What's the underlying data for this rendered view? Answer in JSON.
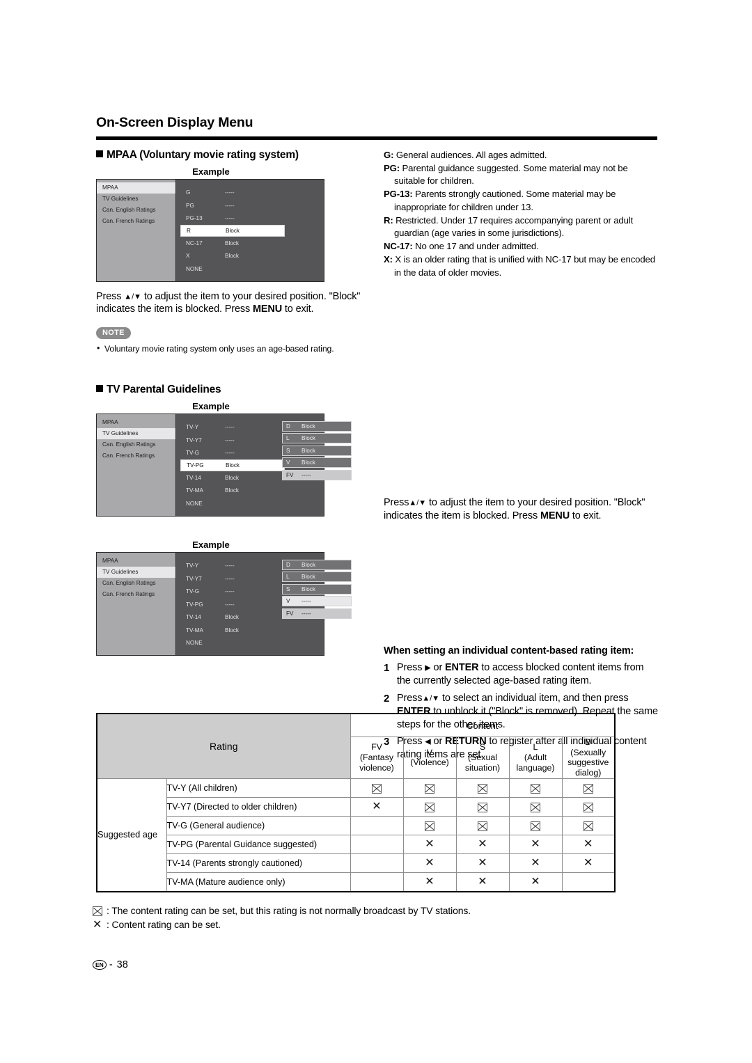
{
  "header": {
    "title": "On-Screen Display Menu"
  },
  "mpaa": {
    "heading": "MPAA (Voluntary movie rating system)",
    "example_label": "Example",
    "osd": {
      "side_items": [
        {
          "label": "MPAA",
          "selected": true
        },
        {
          "label": "TV Guidelines",
          "selected": false
        },
        {
          "label": "Can. English Ratings",
          "selected": false
        },
        {
          "label": "Can. French Ratings",
          "selected": false
        }
      ],
      "rows": [
        {
          "name": "G",
          "value": "-----",
          "selected": false
        },
        {
          "name": "PG",
          "value": "-----",
          "selected": false
        },
        {
          "name": "PG-13",
          "value": "-----",
          "selected": false
        },
        {
          "name": "R",
          "value": "Block",
          "selected": true
        },
        {
          "name": "NC-17",
          "value": "Block",
          "selected": false
        },
        {
          "name": "X",
          "value": "Block",
          "selected": false
        },
        {
          "name": "NONE",
          "value": "",
          "selected": false
        }
      ]
    },
    "press_para_1": "Press ",
    "press_arrows": "▲/▼",
    "press_para_2": " to adjust the item to your desired position. \"Block\" indicates the item is blocked. Press ",
    "press_menu": "MENU",
    "press_para_3": " to exit.",
    "note_badge": "NOTE",
    "note_item": "Voluntary movie rating system only uses an age-based rating."
  },
  "definitions": [
    {
      "term": "G:",
      "text": " General audiences. All ages admitted."
    },
    {
      "term": "PG:",
      "text": " Parental guidance suggested. Some material may not be suitable for children."
    },
    {
      "term": "PG-13:",
      "text": " Parents strongly cautioned. Some material may be inappropriate for children under 13."
    },
    {
      "term": "R:",
      "text": " Restricted. Under 17 requires accompanying parent or adult guardian (age varies in some jurisdictions)."
    },
    {
      "term": "NC-17:",
      "text": " No one 17 and under admitted."
    },
    {
      "term": "X:",
      "text": " X is an older rating that is unified with NC-17 but may be encoded in the data of older movies."
    }
  ],
  "tv_guidelines": {
    "heading": "TV Parental Guidelines",
    "example_label_1": "Example",
    "example_label_2": "Example",
    "osd1": {
      "side_items": [
        {
          "label": "MPAA",
          "selected": false
        },
        {
          "label": "TV Guidelines",
          "selected": true
        },
        {
          "label": "Can. English Ratings",
          "selected": false
        },
        {
          "label": "Can. French Ratings",
          "selected": false
        }
      ],
      "rows": [
        {
          "name": "TV-Y",
          "value": "-----",
          "selected": false
        },
        {
          "name": "TV-Y7",
          "value": "-----",
          "selected": false
        },
        {
          "name": "TV-G",
          "value": "-----",
          "selected": false
        },
        {
          "name": "TV-PG",
          "value": "Block",
          "selected": true
        },
        {
          "name": "TV-14",
          "value": "Block",
          "selected": false
        },
        {
          "name": "TV-MA",
          "value": "Block",
          "selected": false
        },
        {
          "name": "NONE",
          "value": "",
          "selected": false
        }
      ],
      "content_rows": [
        {
          "name": "D",
          "value": "Block",
          "style": "dark"
        },
        {
          "name": "L",
          "value": "Block",
          "style": "dark"
        },
        {
          "name": "S",
          "value": "Block",
          "style": "dark"
        },
        {
          "name": "V",
          "value": "Block",
          "style": "dark"
        },
        {
          "name": "FV",
          "value": "-----",
          "style": "light"
        }
      ]
    },
    "osd2": {
      "side_items": [
        {
          "label": "MPAA",
          "selected": false
        },
        {
          "label": "TV Guidelines",
          "selected": true
        },
        {
          "label": "Can. English Ratings",
          "selected": false
        },
        {
          "label": "Can. French Ratings",
          "selected": false
        }
      ],
      "rows": [
        {
          "name": "TV-Y",
          "value": "-----",
          "selected": false
        },
        {
          "name": "TV-Y7",
          "value": "-----",
          "selected": false
        },
        {
          "name": "TV-G",
          "value": "-----",
          "selected": false
        },
        {
          "name": "TV-PG",
          "value": "-----",
          "selected": false
        },
        {
          "name": "TV-14",
          "value": "Block",
          "selected": false
        },
        {
          "name": "TV-MA",
          "value": "Block",
          "selected": false
        },
        {
          "name": "NONE",
          "value": "",
          "selected": false
        }
      ],
      "content_rows": [
        {
          "name": "D",
          "value": "Block",
          "style": "dark"
        },
        {
          "name": "L",
          "value": "Block",
          "style": "dark"
        },
        {
          "name": "S",
          "value": "Block",
          "style": "dark"
        },
        {
          "name": "V",
          "value": "-----",
          "style": "lighter"
        },
        {
          "name": "FV",
          "value": "-----",
          "style": "light"
        }
      ]
    },
    "press_para_1": "Press",
    "press_arrows": "▲/▼",
    "press_para_2": " to adjust the item to your desired position. \"Block\" indicates the item is blocked. Press ",
    "press_menu": "MENU",
    "press_para_3": " to exit."
  },
  "steps_section": {
    "heading": "When setting an individual content-based rating item:",
    "steps": [
      {
        "num": "1",
        "parts": [
          {
            "t": "Press ",
            "b": false
          },
          {
            "t": "▶",
            "b": false,
            "arrow": true
          },
          {
            "t": " or ",
            "b": false
          },
          {
            "t": "ENTER",
            "b": true
          },
          {
            "t": " to access blocked content items from the currently selected age-based rating item.",
            "b": false
          }
        ]
      },
      {
        "num": "2",
        "parts": [
          {
            "t": "Press",
            "b": false
          },
          {
            "t": "▲/▼",
            "b": false,
            "arrow": true
          },
          {
            "t": " to select an individual item, and then press ",
            "b": false
          },
          {
            "t": "ENTER",
            "b": true
          },
          {
            "t": " to unblock it (\"Block\" is removed). Repeat the same steps for the other items.",
            "b": false
          }
        ]
      },
      {
        "num": "3",
        "parts": [
          {
            "t": "Press ",
            "b": false
          },
          {
            "t": "◀",
            "b": false,
            "arrow": true
          },
          {
            "t": " or ",
            "b": false
          },
          {
            "t": "RETURN",
            "b": true
          },
          {
            "t": " to register after all individual content rating items are set.",
            "b": false
          }
        ]
      }
    ]
  },
  "rating_table": {
    "rating_header": "Rating",
    "content_header": "Content",
    "suggested_age_label": "Suggested age",
    "columns": [
      {
        "code": "FV",
        "desc": "(Fantasy violence)"
      },
      {
        "code": "V",
        "desc": "(Violence)"
      },
      {
        "code": "S",
        "desc": "(Sexual situation)"
      },
      {
        "code": "L",
        "desc": "(Adult language)"
      },
      {
        "code": "D",
        "desc": "(Sexually suggestive dialog)"
      }
    ],
    "rows": [
      {
        "label": "TV-Y (All children)",
        "marks": [
          "box",
          "box",
          "box",
          "box",
          "box"
        ]
      },
      {
        "label": "TV-Y7 (Directed to older children)",
        "marks": [
          "x",
          "box",
          "box",
          "box",
          "box"
        ]
      },
      {
        "label": "TV-G (General audience)",
        "marks": [
          "",
          "box",
          "box",
          "box",
          "box"
        ]
      },
      {
        "label": "TV-PG (Parental Guidance suggested)",
        "marks": [
          "",
          "x",
          "x",
          "x",
          "x"
        ]
      },
      {
        "label": "TV-14 (Parents strongly cautioned)",
        "marks": [
          "",
          "x",
          "x",
          "x",
          "x"
        ]
      },
      {
        "label": "TV-MA (Mature audience only)",
        "marks": [
          "",
          "x",
          "x",
          "x",
          ""
        ]
      }
    ]
  },
  "legend": [
    {
      "symbol": "box",
      "text": ": The content rating can be set, but this rating is not normally broadcast by TV stations."
    },
    {
      "symbol": "x",
      "text": ": Content rating can be set."
    }
  ],
  "footer": {
    "lang_badge": "EN",
    "separator": "-",
    "page_number": "38"
  }
}
